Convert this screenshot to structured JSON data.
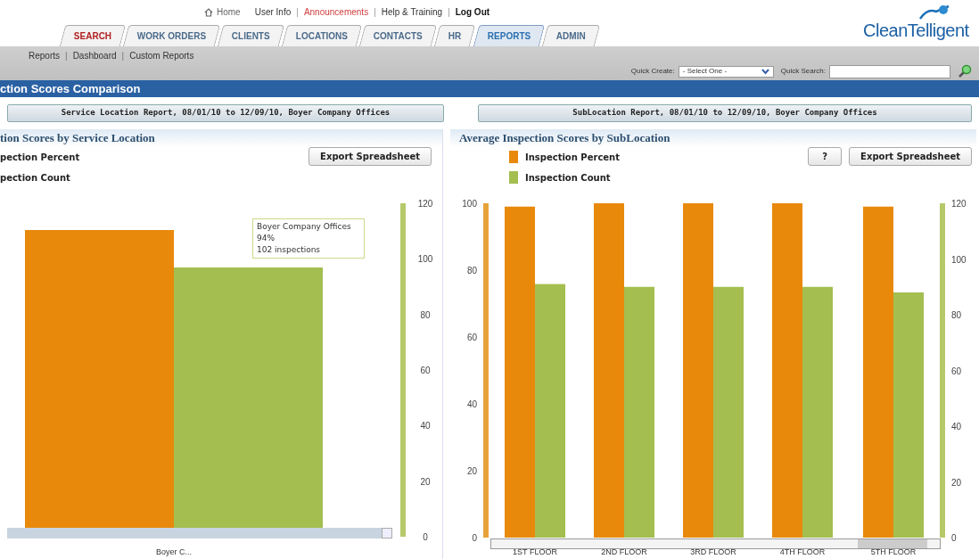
{
  "top_links": [
    {
      "label": "Home",
      "kind": "home"
    },
    {
      "label": "User Info",
      "kind": "normal"
    },
    {
      "label": "Announcements",
      "kind": "alert"
    },
    {
      "label": "Help & Training",
      "kind": "normal"
    },
    {
      "label": "Log Out",
      "kind": "bold"
    }
  ],
  "link_divider": "|",
  "logo": {
    "text_a": "Clean",
    "text_b": "Telligent"
  },
  "tabs": [
    {
      "label": "SEARCH",
      "selected": false,
      "highlighted": true
    },
    {
      "label": "WORK ORDERS",
      "selected": false,
      "highlighted": false
    },
    {
      "label": "CLIENTS",
      "selected": false,
      "highlighted": false
    },
    {
      "label": "LOCATIONS",
      "selected": false,
      "highlighted": false
    },
    {
      "label": "CONTACTS",
      "selected": false,
      "highlighted": false
    },
    {
      "label": "HR",
      "selected": false,
      "highlighted": false
    },
    {
      "label": "REPORTS",
      "selected": true,
      "highlighted": false
    },
    {
      "label": "ADMIN",
      "selected": false,
      "highlighted": false
    }
  ],
  "subnav": [
    "Reports",
    "Dashboard",
    "Custom Reports"
  ],
  "quick_create": {
    "label": "Quick Create:",
    "value": "- Select One -"
  },
  "quick_search": {
    "label": "Quick Search:"
  },
  "page_title": "ction Scores Comparison",
  "report_buttons": [
    "Service Location Report, 08/01/10 to 12/09/10, Boyer Company Offices",
    "SubLocation Report, 08/01/10 to 12/09/10, Boyer Company Offices"
  ],
  "left_panel": {
    "title": "tion Scores by Service Location",
    "buttons": [
      "Export Spreadsheet"
    ],
    "tooltip": [
      "Boyer Company Offices",
      "94%",
      "102 inspections"
    ],
    "legend": [
      "pection Percent",
      "pection Count"
    ],
    "axis_labels": [
      "120",
      "100",
      "80",
      "60",
      "40",
      "20",
      "0"
    ],
    "category_label": "Boyer C..."
  },
  "right_panel": {
    "title": "Average Inspection Scores by SubLocation",
    "buttons": [
      "?",
      "Export Spreadsheet"
    ],
    "chart_data": {
      "type": "bar",
      "categories": [
        "1ST FLOOR",
        "2ND FLOOR",
        "3RD FLOOR",
        "4TH FLOOR",
        "5TH FLOOR"
      ],
      "series": [
        {
          "name": "Inspection Percent",
          "color": "#e8890c",
          "values": [
            99,
            100,
            100,
            100,
            99
          ]
        },
        {
          "name": "Inspection Count",
          "color": "#a4be50",
          "values": [
            91,
            90,
            90,
            90,
            88
          ],
          "axis": "y2"
        }
      ],
      "ylim": [
        0,
        100
      ],
      "yticks": [
        0,
        20,
        40,
        60,
        80,
        100
      ],
      "y2lim": [
        0,
        120
      ],
      "y2ticks": [
        0,
        20,
        40,
        60,
        80,
        100,
        120
      ]
    }
  }
}
